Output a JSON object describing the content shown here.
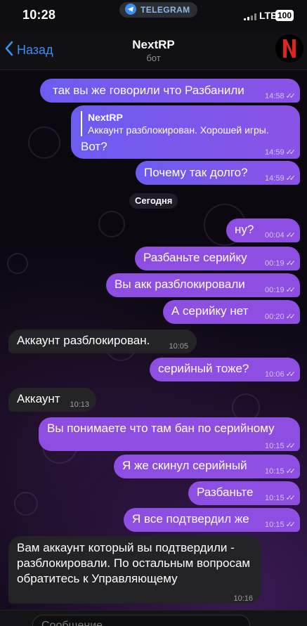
{
  "status_bar": {
    "time": "10:28",
    "app_pill": "TELEGRAM",
    "network": "LTE",
    "battery": "100"
  },
  "header": {
    "back_label": "Назад",
    "title": "NextRP",
    "subtitle": "бот"
  },
  "date_separator": "Сегодня",
  "messages": [
    {
      "text": "так вы же говорили что Разбанили",
      "time": "14:58"
    },
    {
      "reply_name": "NextRP",
      "reply_text": "Аккаунт разблокирован. Хорошей игры.",
      "text": "Вот?",
      "time": "14:59"
    },
    {
      "text": "Почему так долго?",
      "time": "14:59"
    },
    {
      "text": "ну?",
      "time": "00:04"
    },
    {
      "text": "Разбаньте серийку",
      "time": "00:19"
    },
    {
      "text": "Вы акк разблокировали",
      "time": "00:19"
    },
    {
      "text": "А серийку нет",
      "time": "00:20"
    },
    {
      "text": "Аккаунт разблокирован.",
      "time": "10:05"
    },
    {
      "text": "серийный тоже?",
      "time": "10:06"
    },
    {
      "text": "Аккаунт",
      "time": "10:13"
    },
    {
      "text": "Вы понимаете что там бан по серийному",
      "time": "10:15"
    },
    {
      "text": "Я же скинул серийный",
      "time": "10:15"
    },
    {
      "text": "Разбаньте",
      "time": "10:15"
    },
    {
      "text": "Я все подтвердил же",
      "time": "10:15"
    },
    {
      "text": "Вам аккаунт который вы подтвердили - разблокировали. По остальным вопросам обратитесь к Управляющему",
      "time": "10:16"
    }
  ],
  "input": {
    "placeholder": "Сообщение"
  }
}
